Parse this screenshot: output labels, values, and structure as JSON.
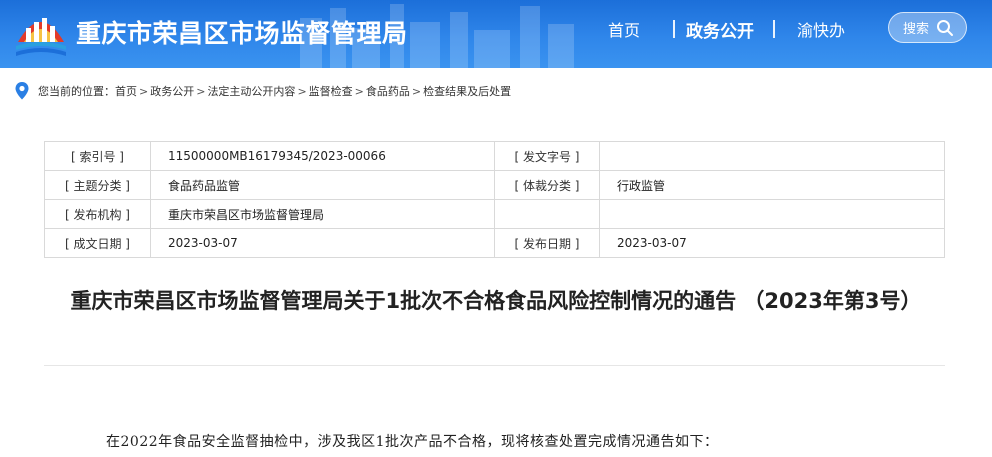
{
  "header": {
    "site_title": "重庆市荣昌区市场监督管理局",
    "nav": {
      "home": "首页",
      "gov": "政务公开",
      "yu": "渝快办"
    },
    "search_label": "搜索",
    "bg_color": "#2a7fe4"
  },
  "breadcrumb": {
    "prefix": "您当前的位置：",
    "items": [
      "首页",
      "政务公开",
      "法定主动公开内容",
      "监督检查",
      "食品药品",
      "检查结果及后处置"
    ],
    "sep": ">"
  },
  "meta": {
    "rows": [
      {
        "k1": "[ 索引号 ]",
        "v1": "11500000MB16179345/2023-00066",
        "k2": "[ 发文字号 ]",
        "v2": ""
      },
      {
        "k1": "[ 主题分类 ]",
        "v1": "食品药品监管",
        "k2": "[ 体裁分类 ]",
        "v2": "行政监管"
      },
      {
        "k1": "[ 发布机构 ]",
        "v1": "重庆市荣昌区市场监督管理局",
        "k2": "",
        "v2": ""
      },
      {
        "k1": "[ 成文日期 ]",
        "v1": "2023-03-07",
        "k2": "[ 发布日期 ]",
        "v2": "2023-03-07"
      }
    ]
  },
  "article": {
    "title": "重庆市荣昌区市场监督管理局关于1批次不合格食品风险控制情况的通告 （2023年第3号）",
    "first_paragraph": "在2022年食品安全监督抽检中，涉及我区1批次产品不合格，现将核查处置完成情况通告如下："
  }
}
